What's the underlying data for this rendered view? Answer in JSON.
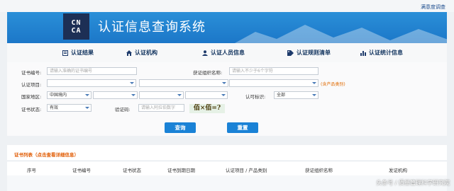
{
  "top_link": "满意度调查",
  "logo_text": [
    "CN",
    "CA"
  ],
  "site_title": "认证信息查询系统",
  "nav": [
    "认证结果",
    "认证机构",
    "认证人员信息",
    "认证规则清单",
    "认证统计信息"
  ],
  "form": {
    "cert_no_label": "证书编号:",
    "cert_no_placeholder": "请输入准确的证书编号",
    "org_name_label": "获证组织名称:",
    "org_name_placeholder": "请输入不少于6个字符",
    "project_label": "认证项目:",
    "product_note": "(含产品类别)",
    "region_label": "国家地区:",
    "region_value": "中国境内",
    "mark_label": "认可标识:",
    "mark_value": "全部",
    "status_label": "证书状态:",
    "status_value": "有效",
    "captcha_label": "验证码:",
    "captcha_placeholder": "请输入阿拉伯数字",
    "captcha_text": "佰×佰=?"
  },
  "buttons": {
    "search": "查询",
    "reset": "重置"
  },
  "results": {
    "header": "证书列表（点击查看详细信息）",
    "columns": [
      "序号",
      "证书编号",
      "证书状态",
      "证书到期日期",
      "认证项目 / 产品类别",
      "获证组织名称",
      "发证机构"
    ]
  },
  "watermark": "头条号 / 质量管理科学研究院"
}
